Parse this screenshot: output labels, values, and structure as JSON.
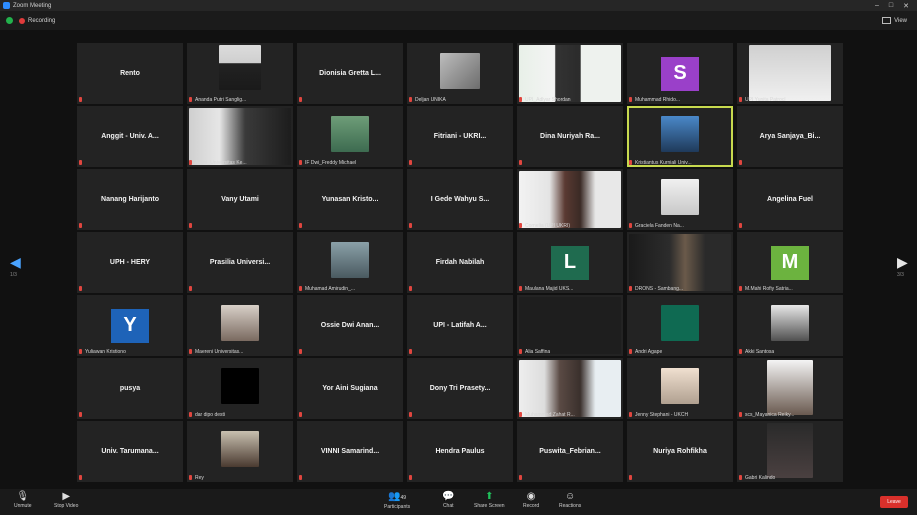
{
  "window": {
    "title": "Zoom Meeting"
  },
  "status": {
    "recording": "Recording",
    "view": "View"
  },
  "colors": {
    "tile_bg": "#232323",
    "active_border": "#c7d94e",
    "muted": "#e0463f",
    "end": "#d9302b"
  },
  "pages": {
    "left": "1/3",
    "right": "3/3"
  },
  "tiles": [
    {
      "big": "Rento"
    },
    {
      "small": "Ananda Putri Sanglig..."
    },
    {
      "big": "Dionisia Gretta L..."
    },
    {
      "small": "Deljan UNIKA"
    },
    {
      "small": "UPI_Adlyar Shordan"
    },
    {
      "small": "Muhammad Rhido..."
    },
    {
      "small": "UPI Yunita Patrocl"
    },
    {
      "big": "Anggit - Univ. A..."
    },
    {
      "small": "Ayuni_Universitas Ke..."
    },
    {
      "small": "IF Dwi_Freddy Michael"
    },
    {
      "big": "Fitriani - UKRI..."
    },
    {
      "big": "Dina Nuriyah Ra..."
    },
    {
      "small": "Kristiantus Kurniali Univ..."
    },
    {
      "big": "Arya Sanjaya_Bi..."
    },
    {
      "big": "Nanang Harijanto"
    },
    {
      "big": "Vany Utami"
    },
    {
      "big": "Yunasan Kristo..."
    },
    {
      "big": "I Gede Wahyu S..."
    },
    {
      "small": "Cornelia (UPI UKRI)"
    },
    {
      "small": "Graciela Fanden Na..."
    },
    {
      "big": "Angelina Fuel"
    },
    {
      "big": "UPH - HERY"
    },
    {
      "big": "Prasilia Universi..."
    },
    {
      "small": "Muhamad Amirudin_..."
    },
    {
      "big": "Firdah Nabilah"
    },
    {
      "small": "Maulana Majid UKS..."
    },
    {
      "small": "DRONS - Sambang..."
    },
    {
      "small": "M.Mahi Rofiy Satria..."
    },
    {
      "small": "Yuliawan Kristiono"
    },
    {
      "small": "Maereni Universitas..."
    },
    {
      "big": "Ossie Dwi Anan..."
    },
    {
      "big": "UPI - Latifah A..."
    },
    {
      "small": "Alia Saffina"
    },
    {
      "small": "Andri Agape"
    },
    {
      "small": "Akki Santosa"
    },
    {
      "big": "pusya"
    },
    {
      "small": "dar dipo desti"
    },
    {
      "big": "Yor Aini Sugiana"
    },
    {
      "big": "Dony Tri Prasety..."
    },
    {
      "small": "Muhammad Zahat R..."
    },
    {
      "small": "Jenny Stephani - UKCH"
    },
    {
      "small": "scs_Mayanica Reiky..."
    },
    {
      "big": "Univ. Tarumana..."
    },
    {
      "small": "Rey"
    },
    {
      "big": "VINNI Samarind..."
    },
    {
      "big": "Hendra Paulus"
    },
    {
      "big": "Puswita_Febrian..."
    },
    {
      "big": "Nuriya Rohfikha"
    },
    {
      "small": "Gabri Kalindo"
    }
  ],
  "letters": {
    "S": "S",
    "L": "L",
    "M": "M",
    "Y": "Y"
  },
  "toolbar": {
    "unmute": "Unmute",
    "video": "Stop Video",
    "participants": "Participants",
    "participants_count": "49",
    "chat": "Chat",
    "share": "Share Screen",
    "record": "Record",
    "reactions": "Reactions",
    "end": "Leave"
  }
}
